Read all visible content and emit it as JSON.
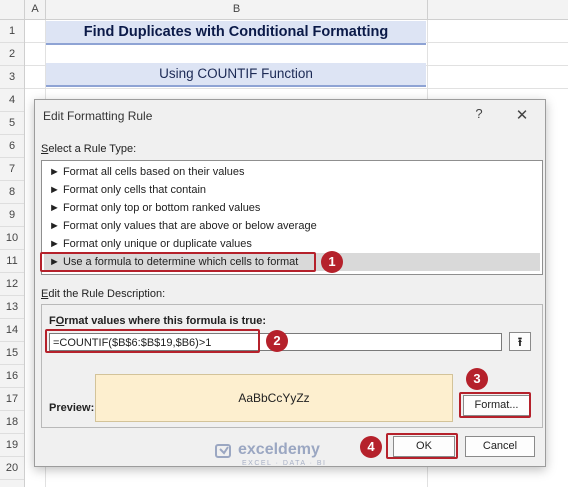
{
  "sheet": {
    "columns": [
      "A",
      "B"
    ],
    "rows": [
      "1",
      "2",
      "3",
      "4",
      "5",
      "6",
      "7",
      "8",
      "9",
      "10",
      "11",
      "12",
      "13",
      "14",
      "15",
      "16",
      "17",
      "18",
      "19",
      "20"
    ],
    "title": "Find Duplicates with Conditional Formatting",
    "subtitle": "Using COUNTIF Function"
  },
  "dialog": {
    "title": "Edit Formatting Rule",
    "help_symbol": "?",
    "close_symbol": "✕",
    "rule_type_label_key": "S",
    "rule_type_label_rest": "elect a Rule Type:",
    "rule_types": [
      "► Format all cells based on their values",
      "► Format only cells that contain",
      "► Format only top or bottom ranked values",
      "► Format only values that are above or below average",
      "► Format only unique or duplicate values",
      "► Use a formula to determine which cells to format"
    ],
    "description_label_key": "E",
    "description_label_rest": "dit the Rule Description:",
    "formula_label_key": "O",
    "formula_label_pre": "F",
    "formula_label_rest": "rmat values where this formula is true:",
    "formula_value": "=COUNTIF($B$6:$B$19,$B6)>1",
    "collapse_symbol": "⭱",
    "preview_label": "Preview:",
    "preview_sample": "AaBbCcYyZz",
    "format_button": "Format...",
    "ok_button": "OK",
    "cancel_button": "Cancel"
  },
  "callouts": [
    "1",
    "2",
    "3",
    "4"
  ],
  "watermark": {
    "name": "exceldemy",
    "tagline": "EXCEL · DATA · BI"
  },
  "colors": {
    "callout": "#b5212b",
    "title_fill": "#dde4f4",
    "preview_fill": "#fdefcf"
  }
}
